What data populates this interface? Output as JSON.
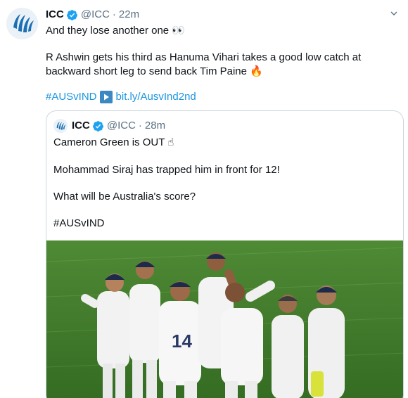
{
  "tweet": {
    "author_name": "ICC",
    "handle": "@ICC",
    "separator": "·",
    "time": "22m",
    "line1": "And they lose another one 👀",
    "para2": "R Ashwin gets his third as Hanuma Vihari takes a good low catch at backward short leg to send back Tim Paine 🔥",
    "hashtag": "#AUSvIND",
    "link": "bit.ly/AusvInd2nd",
    "avatar_icon": "icc-logo-icon",
    "verified_icon": "verified-badge-icon",
    "more_icon": "chevron-down-icon"
  },
  "quote": {
    "author_name": "ICC",
    "handle": "@ICC",
    "separator": "·",
    "time": "28m",
    "line1": "Cameron Green is OUT ☝",
    "line2": "Mohammad Siraj has trapped him in front for 12!",
    "line3": "What will be Australia's score?",
    "hashtag": "#AUSvIND",
    "photo_desc_icon": "cricket-team-celebration-photo"
  },
  "colors": {
    "link": "#1b95e0",
    "secondary_text": "#5b7083",
    "verified": "#1da1f2",
    "border": "#ccd6dd",
    "pitch_green": "#3f7a2a"
  }
}
